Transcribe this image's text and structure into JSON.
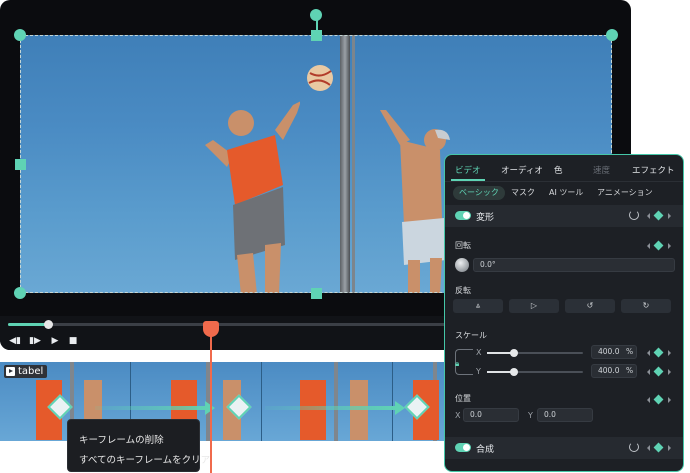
{
  "timeline": {
    "track_label": "tabel",
    "context_menu": {
      "items": [
        "キーフレームの削除",
        "すべてのキーフレームをクリア"
      ]
    }
  },
  "playback": {
    "progress": 0.09,
    "icons": [
      "step-back-icon",
      "step-forward-icon",
      "play-icon",
      "stop-icon"
    ]
  },
  "panel": {
    "tabs": [
      "ビデオ",
      "オーディオ",
      "色",
      "速度",
      "エフェクト"
    ],
    "active_tab": "ビデオ",
    "subtabs": [
      "ベーシック",
      "マスク",
      "AI ツール",
      "アニメーション"
    ],
    "active_subtab": "ベーシック",
    "transform": {
      "title": "変形",
      "rotate": {
        "label": "回転",
        "value": "0.0°"
      },
      "flip": {
        "label": "反転"
      },
      "scale": {
        "label": "スケール",
        "x": {
          "axis": "X",
          "value": "400.0",
          "unit": "%",
          "level": 0.28
        },
        "y": {
          "axis": "Y",
          "value": "400.0",
          "unit": "%",
          "level": 0.28
        }
      },
      "position": {
        "label": "位置",
        "x": {
          "axis": "X",
          "value": "0.0"
        },
        "y": {
          "axis": "Y",
          "value": "0.0"
        }
      }
    },
    "composite": {
      "title": "合成"
    }
  },
  "colors": {
    "accent": "#5fd3b4",
    "playhead": "#f06a4c",
    "panel_bg": "#1d2025"
  }
}
